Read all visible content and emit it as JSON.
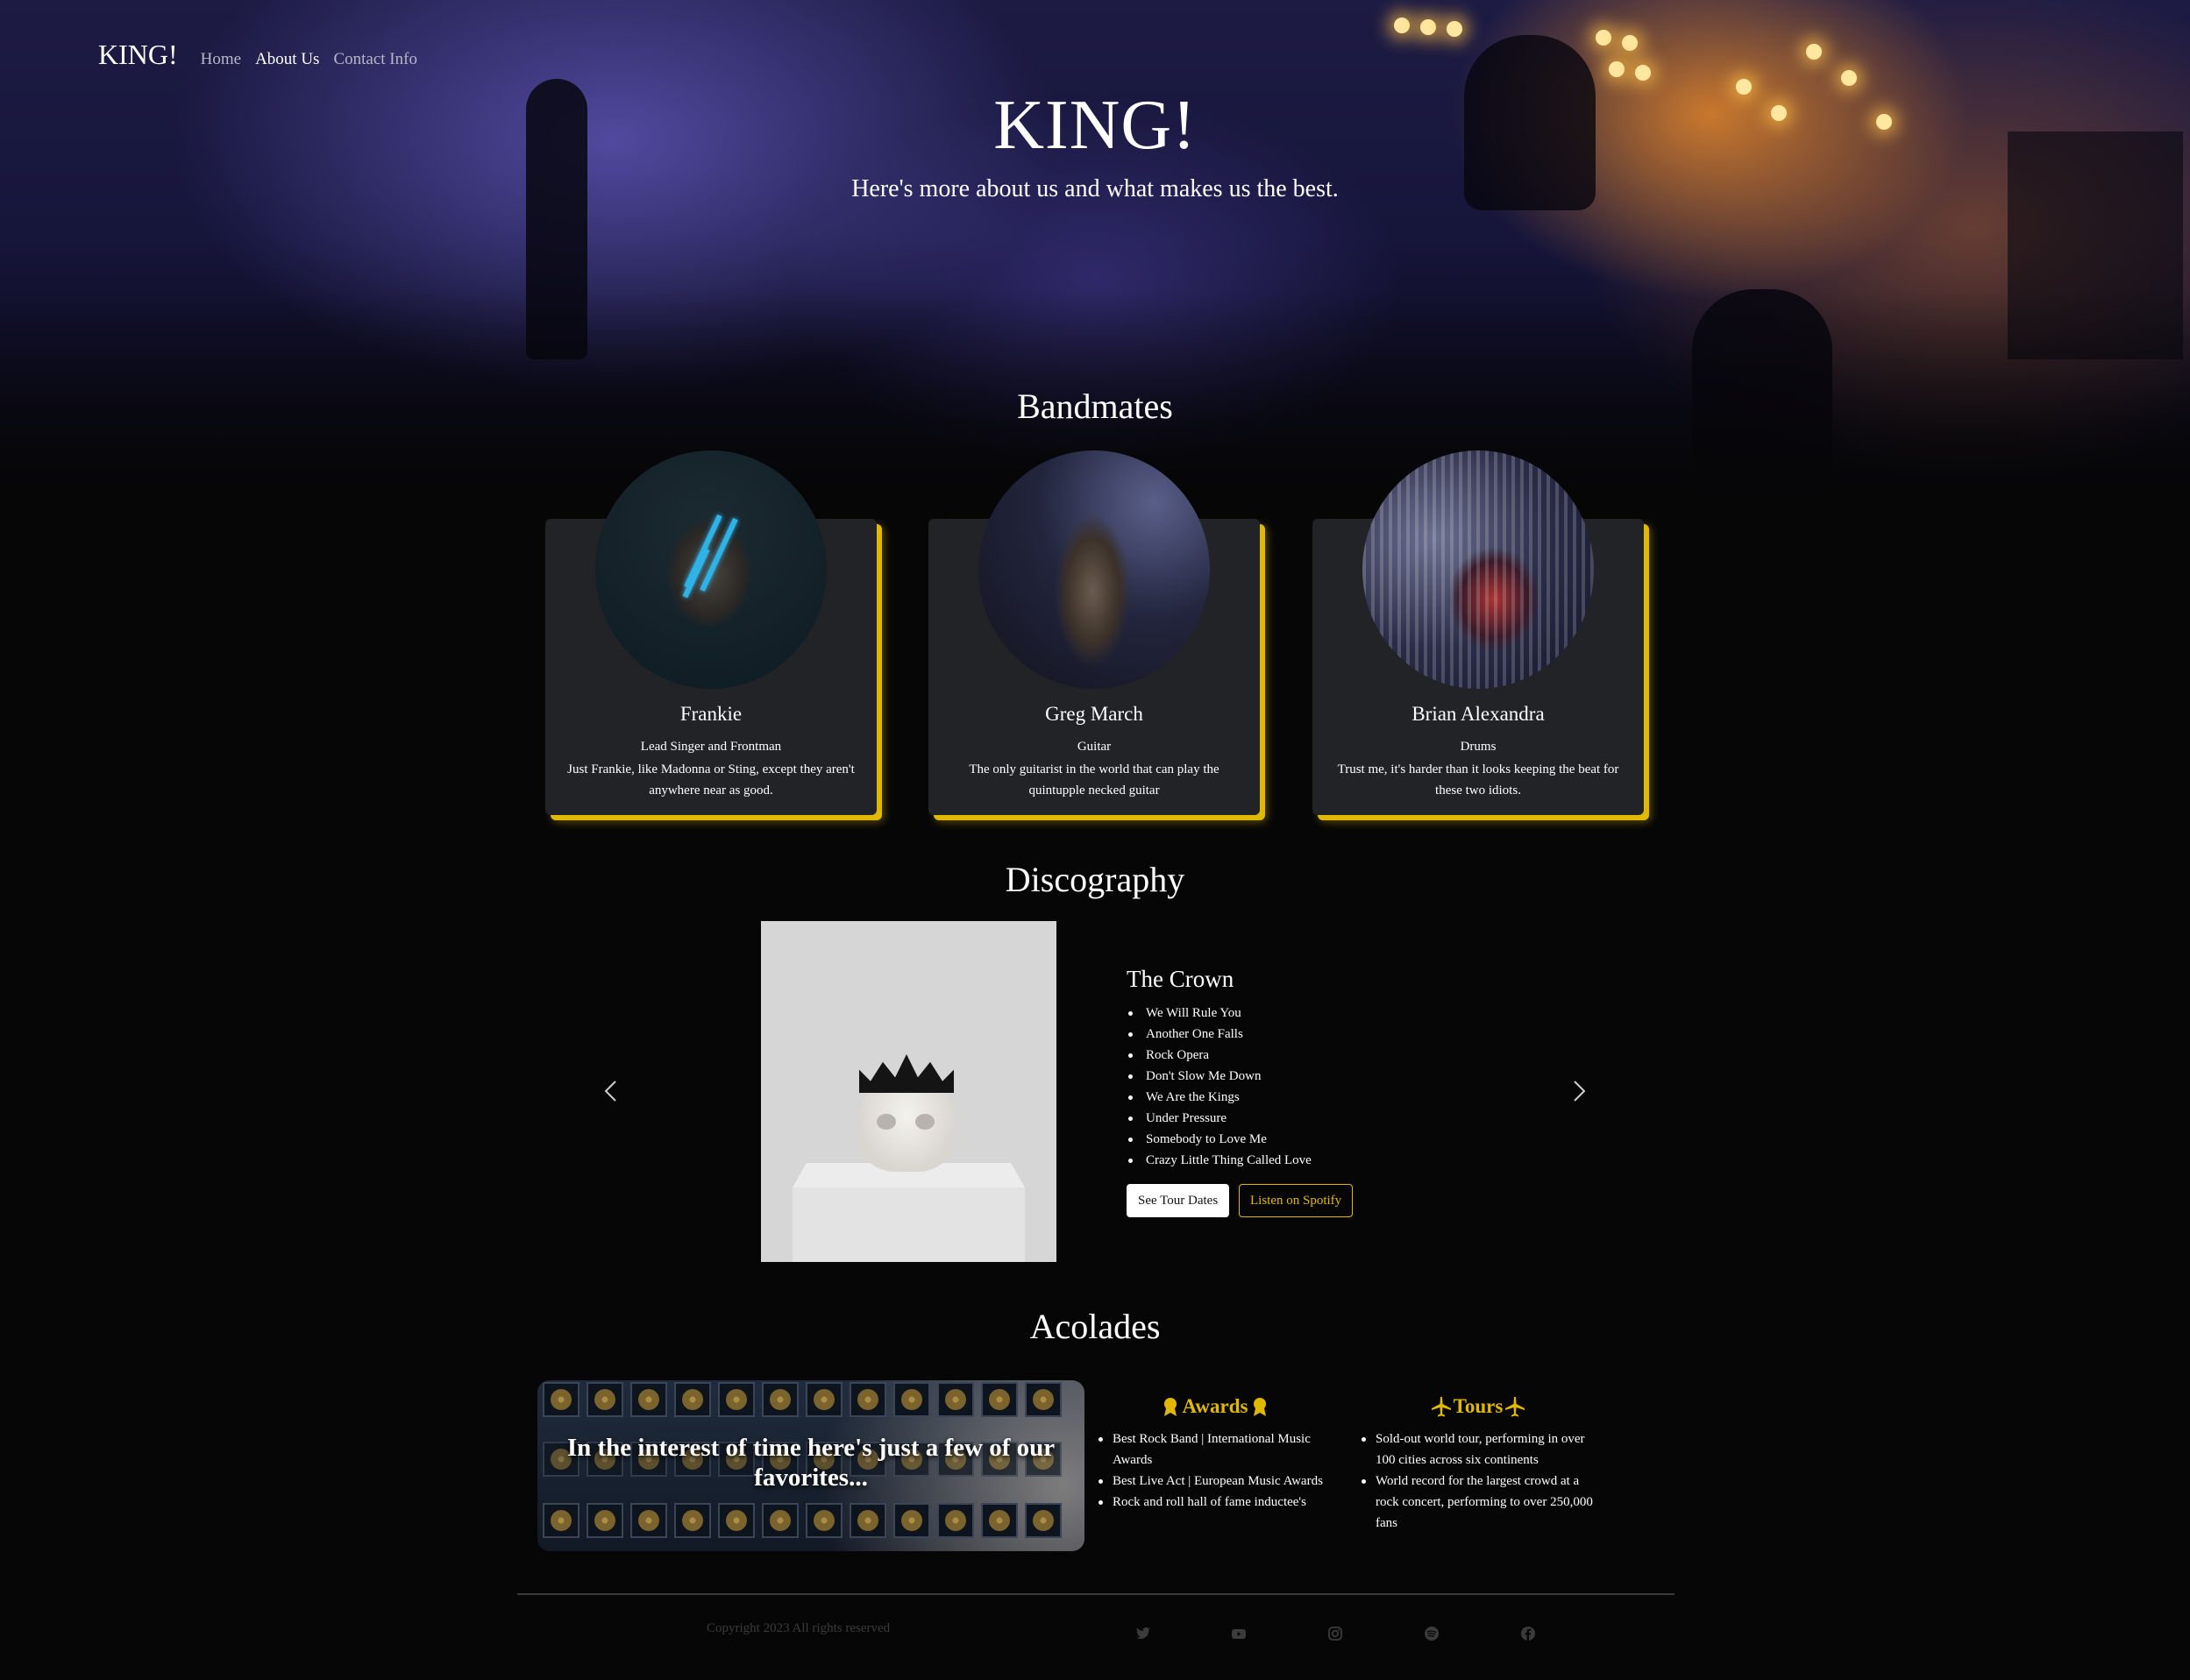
{
  "nav": {
    "brand": "KING!",
    "links": [
      "Home",
      "About Us",
      "Contact Info"
    ],
    "active": "About Us"
  },
  "hero": {
    "title": "KING!",
    "subtitle": "Here's more about us and what makes us the best."
  },
  "bandmates": {
    "title": "Bandmates",
    "members": [
      {
        "name": "Frankie",
        "role": "Lead Singer and Frontman",
        "desc": "Just Frankie, like Madonna or Sting, except they aren't anywhere near as good."
      },
      {
        "name": "Greg March",
        "role": "Guitar",
        "desc": "The only guitarist in the world that can play the quintupple necked guitar"
      },
      {
        "name": "Brian Alexandra",
        "role": "Drums",
        "desc": "Trust me, it's harder than it looks keeping the beat for these two idiots."
      }
    ]
  },
  "discography": {
    "title": "Discography",
    "album": {
      "title": "The Crown",
      "tracks": [
        "We Will Rule You",
        "Another One Falls",
        "Rock Opera",
        "Don't Slow Me Down",
        "We Are the Kings",
        "Under Pressure",
        "Somebody to Love Me",
        "Crazy Little Thing Called Love"
      ]
    },
    "buttons": {
      "tour": "See Tour Dates",
      "spotify": "Listen on Spotify"
    },
    "prev_icon": "chevron-left-icon",
    "next_icon": "chevron-right-icon"
  },
  "acolades": {
    "title": "Acolades",
    "banner_text": "In the interest of time here's just a few of our favorites...",
    "awards": {
      "heading": "Awards",
      "icon": "award-icon",
      "items": [
        "Best Rock Band | International Music Awards",
        "Best Live Act | European Music Awards",
        "Rock and roll hall of fame inductee's"
      ]
    },
    "tours": {
      "heading": "Tours",
      "icon": "airplane-icon",
      "items": [
        "Sold-out world tour, performing in over 100 cities across six continents",
        "World record for the largest crowd at a rock concert, performing to over 250,000 fans"
      ]
    }
  },
  "footer": {
    "copyright": "Copyright 2023 All rights reserved",
    "social": [
      "twitter-icon",
      "youtube-icon",
      "instagram-icon",
      "spotify-icon",
      "facebook-icon"
    ]
  },
  "colors": {
    "accent": "#e0b800",
    "card": "#212327",
    "background": "#060606"
  }
}
